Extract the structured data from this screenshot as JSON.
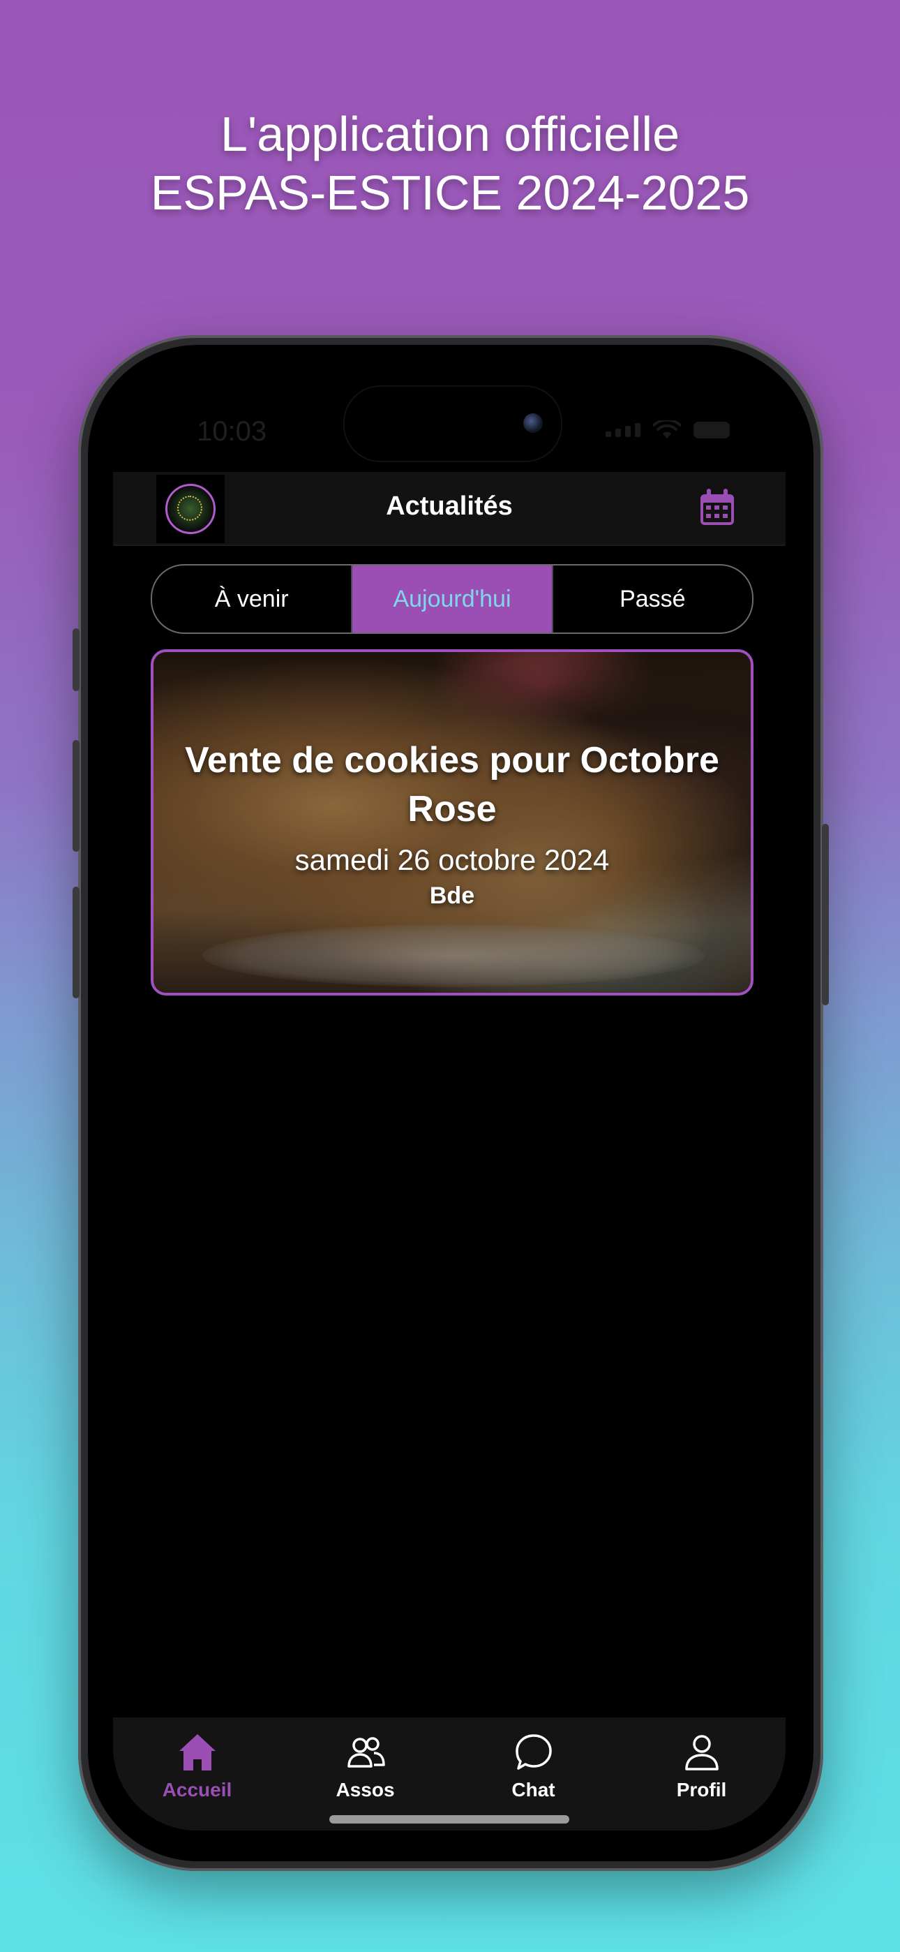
{
  "promo": {
    "line1": "L'application officielle",
    "line2": "ESPAS-ESTICE 2024-2025"
  },
  "status_bar": {
    "time": "10:03"
  },
  "header": {
    "title": "Actualités",
    "logo_icon": "association-logo",
    "calendar_icon": "calendar-icon"
  },
  "segments": {
    "upcoming": "À venir",
    "today": "Aujourd'hui",
    "past": "Passé",
    "selected": "Aujourd'hui"
  },
  "event": {
    "title": "Vente de cookies pour Octobre Rose",
    "date": "samedi 26 octobre 2024",
    "organizer": "Bde"
  },
  "tabbar": {
    "home": "Accueil",
    "assos": "Assos",
    "chat": "Chat",
    "profile": "Profil",
    "active": "Accueil"
  },
  "colors": {
    "accent": "#9b4fb4",
    "active_segment_text": "#7fd7ea",
    "background_top": "#9b56b8",
    "background_bottom": "#5ee0e6"
  }
}
